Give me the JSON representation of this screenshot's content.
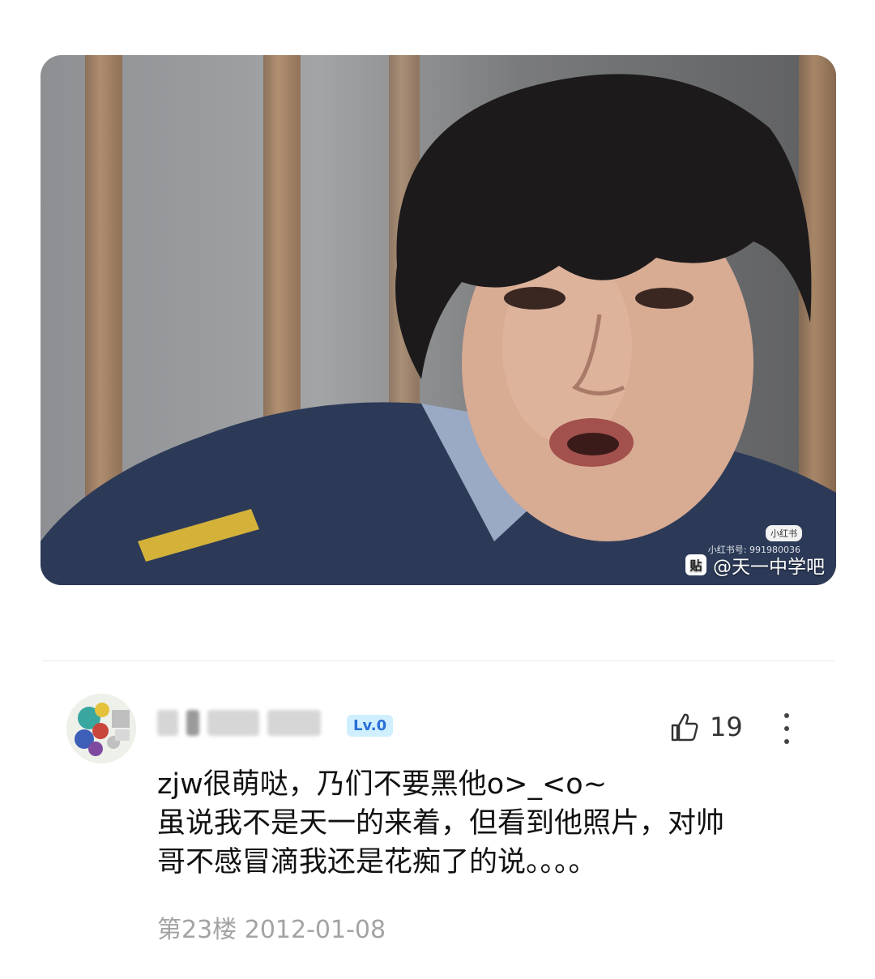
{
  "image_watermark": {
    "badge": "小红书",
    "id_text": "小红书号: 991980036",
    "logo": "贴",
    "source": "@天一中学吧"
  },
  "comment": {
    "level": "Lv.0",
    "like_count": "19",
    "lines": [
      "zjw很萌哒，乃们不要黑他o>_<o~",
      "虽说我不是天一的来着，但看到他照片，对帅",
      "哥不感冒滴我还是花痴了的说。。。。"
    ],
    "floor": "第23楼",
    "date": "2012-01-08"
  },
  "icons": {
    "like": "thumbs-up-icon",
    "more": "more-vertical-icon"
  }
}
